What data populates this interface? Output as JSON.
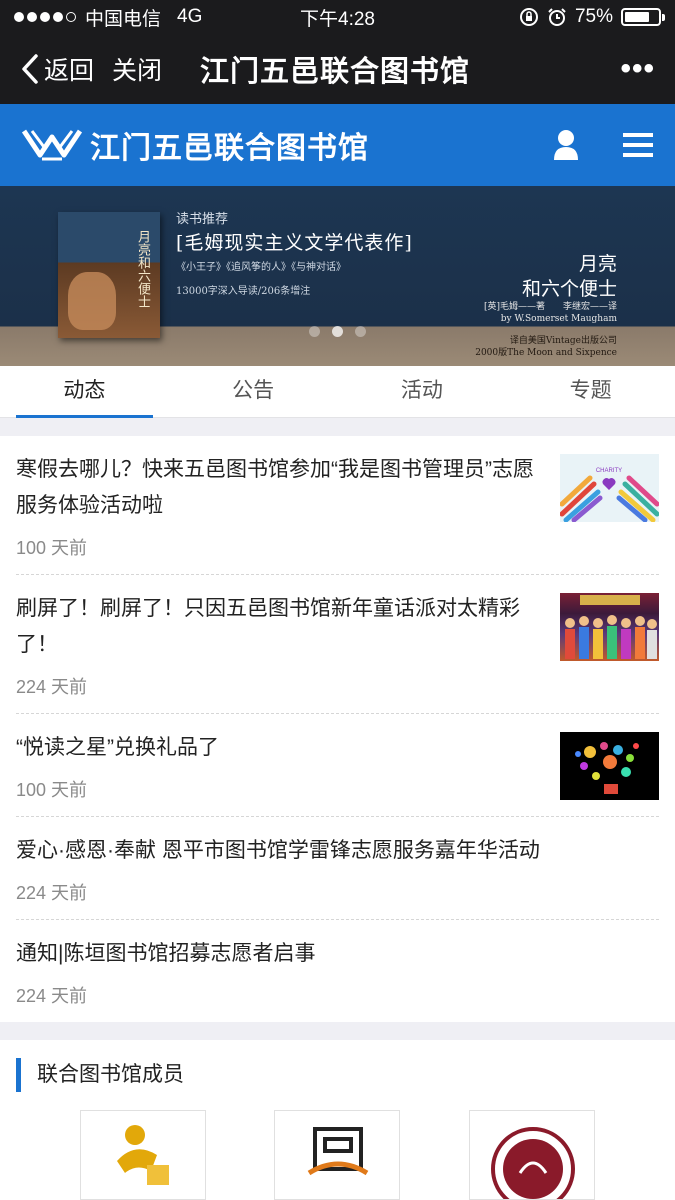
{
  "status": {
    "carrier": "中国电信",
    "network": "4G",
    "time": "下午4:28",
    "battery": "75%",
    "battery_level": 0.75
  },
  "nav": {
    "back": "返回",
    "close": "关闭",
    "title": "江门五邑联合图书馆",
    "more": "•••"
  },
  "site": {
    "title": "江门五邑联合图书馆",
    "brand_color": "#1a73d0"
  },
  "banner": {
    "book_title": "月亮和六便士",
    "recommend": "读书推荐",
    "headline": "[毛姆现实主义文学代表作]",
    "books": "《小王子》《追风筝的人》《与神对话》",
    "words": "13000字深入导读/206条增注",
    "moon_line1": "月亮",
    "moon_line2": "和六个便士",
    "author_line1": "[英]毛姆——著　　李继宏——译",
    "author_line2": "by W.Somerset Maugham",
    "pub_line1": "译自美国Vintage出版公司",
    "pub_line2": "2000版The Moon and Sixpence"
  },
  "tabs": [
    "动态",
    "公告",
    "活动",
    "专题"
  ],
  "news": [
    {
      "title": "寒假去哪儿？快来五邑图书馆参加“我是图书管理员”志愿服务体验活动啦",
      "ago": "100 天前",
      "thumb": "charity",
      "thumb_text": "CHARITY"
    },
    {
      "title": "刷屏了！刷屏了！只因五邑图书馆新年童话派对太精彩了！",
      "ago": "224 天前",
      "thumb": "party"
    },
    {
      "title": "“悦读之星”兑换礼品了",
      "ago": "100 天前",
      "thumb": "star"
    },
    {
      "title": "爱心·感恩·奉献 恩平市图书馆学雷锋志愿服务嘉年华活动",
      "ago": "224 天前"
    },
    {
      "title": "通知|陈垣图书馆招募志愿者启事",
      "ago": "224 天前"
    }
  ],
  "members": {
    "title": "联合图书馆成员"
  }
}
